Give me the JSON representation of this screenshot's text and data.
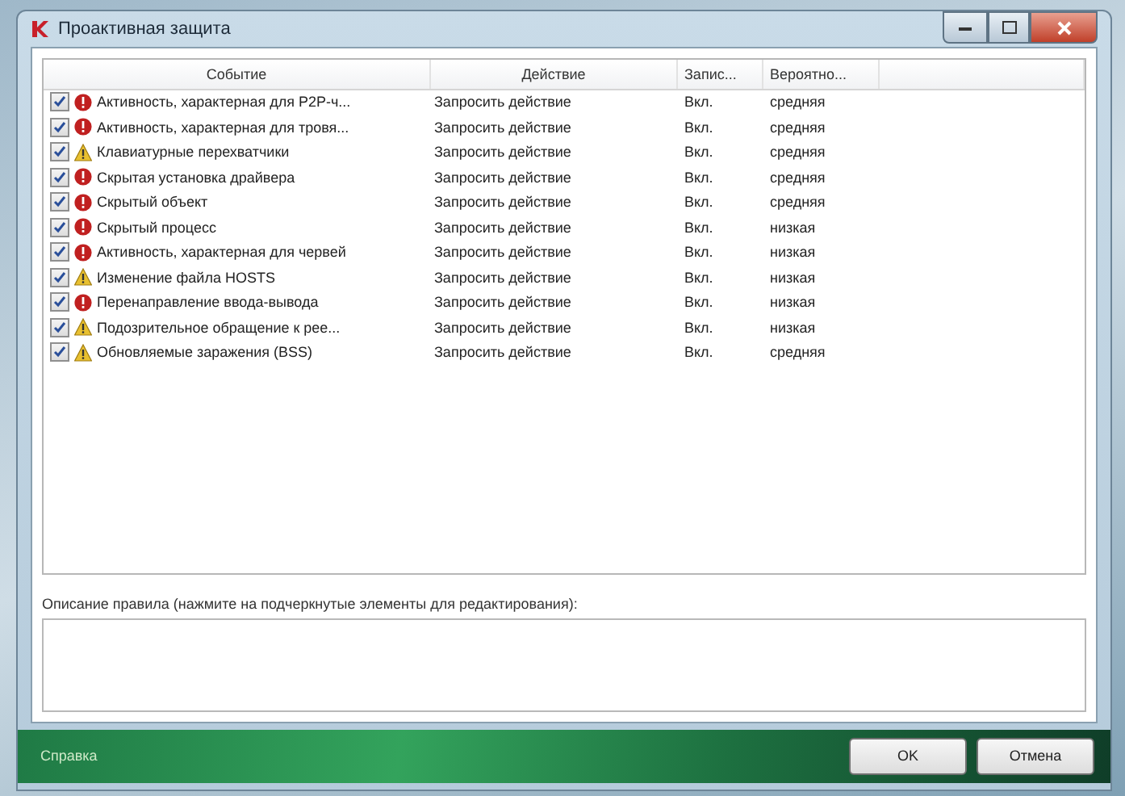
{
  "window": {
    "title": "Проактивная защита"
  },
  "table": {
    "columns": [
      "Событие",
      "Действие",
      "Запис...",
      "Вероятно..."
    ],
    "rows": [
      {
        "checked": true,
        "kind": "danger",
        "event": "Активность, характерная для P2P-ч...",
        "action": "Запросить действие",
        "logging": "Вкл.",
        "probability": "средняя"
      },
      {
        "checked": true,
        "kind": "danger",
        "event": "Активность, характерная для тровя...",
        "action": "Запросить действие",
        "logging": "Вкл.",
        "probability": "средняя"
      },
      {
        "checked": true,
        "kind": "warning",
        "event": "Клавиатурные перехватчики",
        "action": "Запросить действие",
        "logging": "Вкл.",
        "probability": "средняя"
      },
      {
        "checked": true,
        "kind": "danger",
        "event": "Скрытая установка драйвера",
        "action": "Запросить действие",
        "logging": "Вкл.",
        "probability": "средняя"
      },
      {
        "checked": true,
        "kind": "danger",
        "event": "Скрытый объект",
        "action": "Запросить действие",
        "logging": "Вкл.",
        "probability": "средняя"
      },
      {
        "checked": true,
        "kind": "danger",
        "event": "Скрытый процесс",
        "action": "Запросить действие",
        "logging": "Вкл.",
        "probability": "низкая"
      },
      {
        "checked": true,
        "kind": "danger",
        "event": "Активность, характерная для червей",
        "action": "Запросить действие",
        "logging": "Вкл.",
        "probability": "низкая"
      },
      {
        "checked": true,
        "kind": "warning",
        "event": "Изменение файла HOSTS",
        "action": "Запросить действие",
        "logging": "Вкл.",
        "probability": "низкая"
      },
      {
        "checked": true,
        "kind": "danger",
        "event": "Перенаправление ввода-вывода",
        "action": "Запросить действие",
        "logging": "Вкл.",
        "probability": "низкая"
      },
      {
        "checked": true,
        "kind": "warning",
        "event": "Подозрительное обращение к рее...",
        "action": "Запросить действие",
        "logging": "Вкл.",
        "probability": "низкая"
      },
      {
        "checked": true,
        "kind": "warning",
        "event": "Обновляемые заражения (BSS)",
        "action": "Запросить действие",
        "logging": "Вкл.",
        "probability": "средняя"
      }
    ]
  },
  "description": {
    "label": "Описание правила (нажмите на подчеркнутые элементы для редактирования):"
  },
  "footer": {
    "help_link": "Справка",
    "buttons": [
      "OK",
      "Отмена"
    ]
  }
}
